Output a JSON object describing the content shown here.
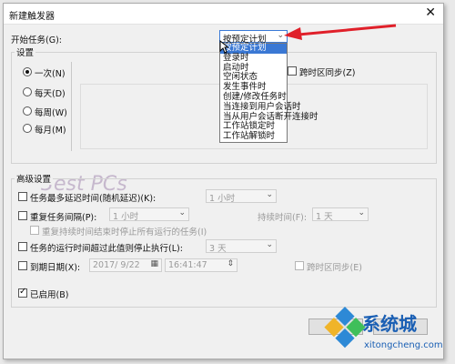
{
  "dialog": {
    "title": "新建触发器",
    "close_glyph": "✕"
  },
  "start_task": {
    "label": "开始任务(G):",
    "value": "按预定计划",
    "options": [
      "按预定计划",
      "登录时",
      "启动时",
      "空闲状态",
      "发生事件时",
      "创建/修改任务时",
      "当连接到用户会话时",
      "当从用户会话断开连接时",
      "工作站锁定时",
      "工作站解锁时"
    ],
    "selected_index": 0
  },
  "settings": {
    "title": "设置",
    "radios": [
      {
        "label": "一次(N)",
        "checked": true
      },
      {
        "label": "每天(D)",
        "checked": false
      },
      {
        "label": "每周(W)",
        "checked": false
      },
      {
        "label": "每月(M)",
        "checked": false
      }
    ],
    "sync_tz_label": "跨时区同步(Z)"
  },
  "advanced": {
    "title": "高级设置",
    "delay_label": "任务最多延迟时间(随机延迟)(K):",
    "delay_value": "1 小时",
    "repeat_label": "重复任务间隔(P):",
    "repeat_value": "1 小时",
    "duration_label": "持续时间(F):",
    "duration_value": "1 天",
    "stop_all_label": "重复持续时间结束时停止所有运行的任务(I)",
    "stop_if_label": "任务的运行时间超过此值则停止执行(L):",
    "stop_if_value": "3 天",
    "expire_label": "到期日期(X):",
    "expire_date": "2017/ 9/22",
    "expire_time": "16:41:47",
    "expire_sync_label": "跨时区同步(E)",
    "enabled_label": "已启用(B)"
  },
  "watermark": {
    "brand": "系统城",
    "url": "xitongcheng.com",
    "faint": "3est PCs"
  },
  "colors": {
    "arrow": "#e0202a",
    "highlight": "#3a78d4",
    "watermark": "#1a5fb4"
  }
}
